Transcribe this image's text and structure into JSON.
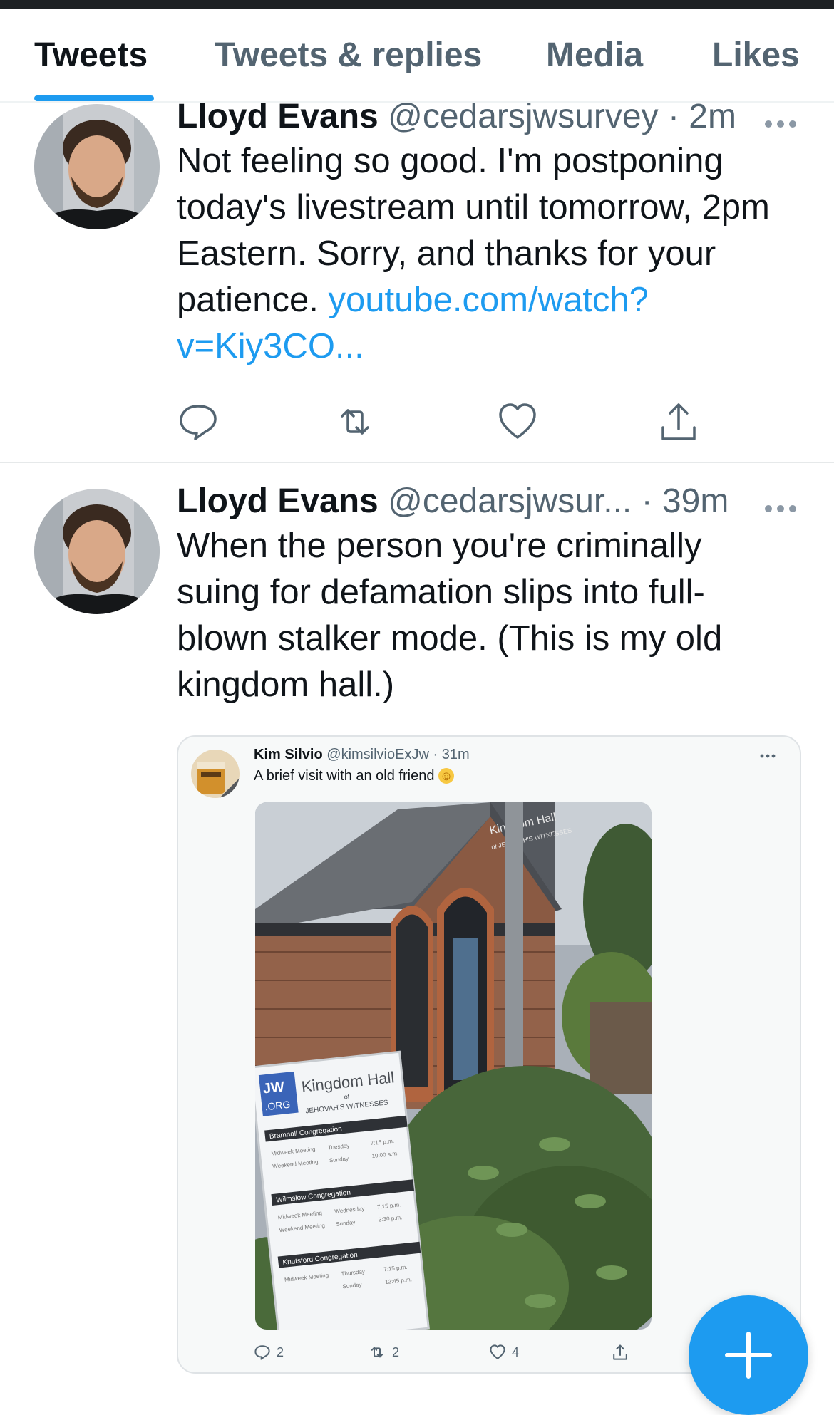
{
  "tabs": [
    {
      "label": "Tweets",
      "active": true
    },
    {
      "label": "Tweets & replies",
      "active": false
    },
    {
      "label": "Media",
      "active": false
    },
    {
      "label": "Likes",
      "active": false
    }
  ],
  "tweets": [
    {
      "name": "Lloyd Evans",
      "handle": "@cedarsjwsurvey",
      "time": "· 2m",
      "text": "Not feeling so good. I'm postponing today's livestream until tomorrow, 2pm Eastern. Sorry, and thanks for your patience. ",
      "link": "youtube.com/watch?v=Kiy3CO...",
      "avatar_icon": "user-avatar-photo",
      "actions": [
        "reply-icon",
        "retweet-icon",
        "like-icon",
        "share-icon"
      ]
    },
    {
      "name": "Lloyd Evans",
      "handle": "@cedarsjwsur...",
      "time": "· 39m",
      "text": "When the person you're criminally suing for defamation slips into full-blown stalker mode. (This is my old kingdom hall.)",
      "avatar_icon": "user-avatar-photo"
    }
  ],
  "quoted": {
    "name": "Kim Silvio",
    "handle": "@kimsilvioExJw",
    "time": "· 31m",
    "text": "A brief visit with an old friend",
    "emoji": "☺",
    "photo": {
      "sign_title": "Kingdom Hall",
      "sign_of": "of",
      "sign_subtitle": "JEHOVAH'S WITNESSES",
      "building_sign": "Kingdom Hall",
      "building_sign_sub": "of JEHOVAH'S WITNESSES",
      "jw_top": "JW",
      "jw_bottom": ".ORG",
      "congregations": [
        {
          "name": "Bramhall Congregation",
          "rows": [
            [
              "Midweek Meeting",
              "Tuesday",
              "7:15 p.m."
            ],
            [
              "Weekend Meeting",
              "Sunday",
              "10:00 a.m."
            ]
          ]
        },
        {
          "name": "Wilmslow Congregation",
          "rows": [
            [
              "Midweek Meeting",
              "Wednesday",
              "7:15 p.m."
            ],
            [
              "Weekend Meeting",
              "Sunday",
              "3:30 p.m."
            ]
          ]
        },
        {
          "name": "Knutsford Congregation",
          "rows": [
            [
              "Midweek Meeting",
              "Thursday",
              "7:15 p.m."
            ],
            [
              "",
              "Sunday",
              "12:45 p.m."
            ]
          ]
        }
      ]
    },
    "counts": {
      "replies": "2",
      "retweets": "2",
      "likes": "4"
    }
  },
  "colors": {
    "accent": "#1d9bf0",
    "text": "#0f1419",
    "muted": "#536471"
  }
}
